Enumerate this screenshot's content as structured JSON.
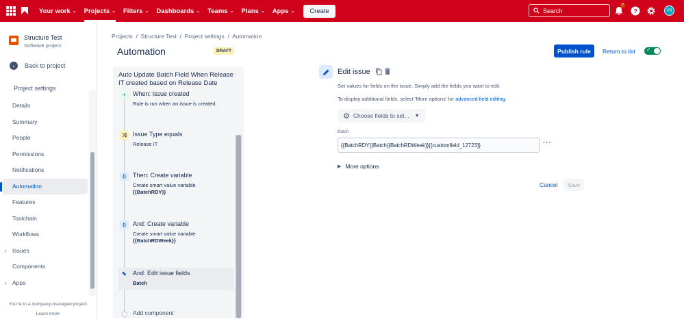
{
  "topbar": {
    "nav": [
      {
        "label": "Your work",
        "dropdown": true,
        "active": false
      },
      {
        "label": "Projects",
        "dropdown": true,
        "active": true
      },
      {
        "label": "Filters",
        "dropdown": true,
        "active": false
      },
      {
        "label": "Dashboards",
        "dropdown": true,
        "active": false
      },
      {
        "label": "Teams",
        "dropdown": true,
        "active": false
      },
      {
        "label": "Plans",
        "dropdown": true,
        "active": false
      },
      {
        "label": "Apps",
        "dropdown": true,
        "active": false
      }
    ],
    "create_label": "Create",
    "search_placeholder": "Search",
    "notification_count": "7",
    "avatar_initials": "VR",
    "colors": {
      "bar": "#d0021b"
    }
  },
  "sidebar": {
    "project_name": "Structure Test",
    "project_type": "Software project",
    "back_label": "Back to project",
    "section_title": "Project settings",
    "items": [
      {
        "label": "Details",
        "active": false,
        "expandable": false
      },
      {
        "label": "Summary",
        "active": false,
        "expandable": false
      },
      {
        "label": "People",
        "active": false,
        "expandable": false
      },
      {
        "label": "Permissions",
        "active": false,
        "expandable": false
      },
      {
        "label": "Notifications",
        "active": false,
        "expandable": false
      },
      {
        "label": "Automation",
        "active": true,
        "expandable": false
      },
      {
        "label": "Features",
        "active": false,
        "expandable": false
      },
      {
        "label": "Toolchain",
        "active": false,
        "expandable": false
      },
      {
        "label": "Workflows",
        "active": false,
        "expandable": false
      },
      {
        "label": "Issues",
        "active": false,
        "expandable": true
      },
      {
        "label": "Components",
        "active": false,
        "expandable": false
      },
      {
        "label": "Apps",
        "active": false,
        "expandable": true
      }
    ],
    "footer_text": "You're in a company-managed project",
    "footer_link": "Learn more"
  },
  "header": {
    "breadcrumb": [
      "Projects",
      "Structure Test",
      "Project settings",
      "Automation"
    ],
    "title": "Automation",
    "status_badge": "DRAFT",
    "publish_label": "Publish rule",
    "return_label": "Return to list",
    "rule_enabled": true
  },
  "rule": {
    "title": "Auto Update Batch Field When Release IT created based on Release Date",
    "components": [
      {
        "kind": "trigger",
        "icon": "plus-icon",
        "title": "When: Issue created",
        "desc": "Rule is run when an issue is created.",
        "desc_bold": ""
      },
      {
        "kind": "condition",
        "icon": "shuffle-icon",
        "title": "Issue Type equals",
        "desc": "Release IT",
        "desc_bold": ""
      },
      {
        "kind": "variable",
        "icon": "braces-icon",
        "title": "Then: Create variable",
        "desc": "Create smart value variable",
        "desc_bold": "{{BatchRDY}}"
      },
      {
        "kind": "variable",
        "icon": "braces-icon",
        "title": "And: Create variable",
        "desc": "Create smart value variable",
        "desc_bold": "{{BatchRDWeek}}"
      },
      {
        "kind": "edit",
        "icon": "pencil-icon",
        "title": "And: Edit issue fields",
        "desc": "",
        "desc_bold": "Batch"
      }
    ],
    "add_component_label": "Add component"
  },
  "edit_panel": {
    "title": "Edit issue",
    "intro": "Set values for fields on the issue. Simply add the fields you want to edit.",
    "additional_prefix": "To display additional fields, select 'More options' for ",
    "additional_link": "advanced field editing.",
    "choose_fields_label": "Choose fields to set...",
    "field_label": "Batch",
    "field_value": "{{BatchRDY}}Batch{{BatchRDWeek}}{{customfield_12723}}",
    "more_options_label": "More options",
    "cancel_label": "Cancel",
    "save_label": "Save"
  }
}
